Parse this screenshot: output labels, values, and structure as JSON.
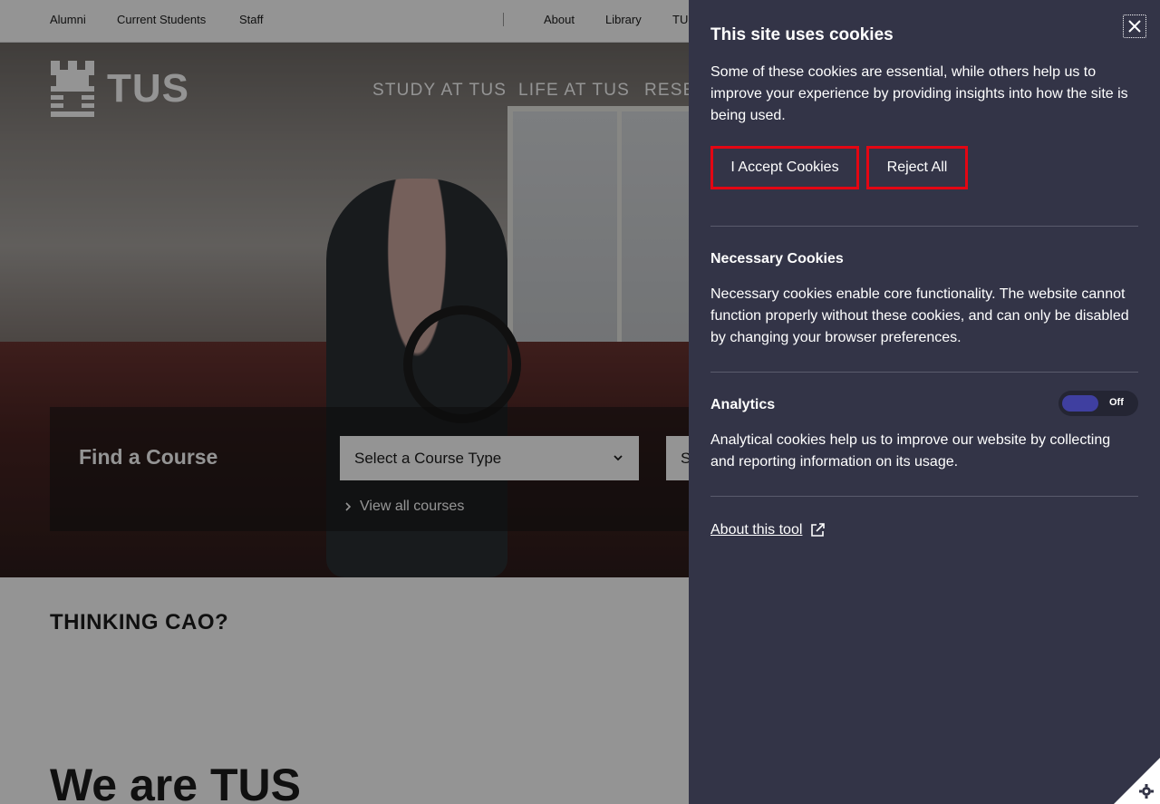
{
  "topbar": {
    "left_links": [
      "Alumni",
      "Current Students",
      "Staff"
    ],
    "right_links": [
      "About",
      "Library",
      "TUS"
    ]
  },
  "logo": {
    "text": "TUS"
  },
  "nav": {
    "items": [
      "STUDY AT TUS",
      "LIFE AT TUS",
      "RESE"
    ]
  },
  "find_course": {
    "title": "Find a Course",
    "course_type_select": "Select a Course Type",
    "second_select": "S",
    "view_all": "View all courses"
  },
  "cao": {
    "title": "THINKING CAO?"
  },
  "intro": {
    "heading": "We are TUS"
  },
  "cookie": {
    "title": "This site uses cookies",
    "intro": "Some of these cookies are essential, while others help us to improve your experience by providing insights into how the site is being used.",
    "accept_label": "I Accept Cookies",
    "reject_label": "Reject All",
    "necessary_title": "Necessary Cookies",
    "necessary_text": "Necessary cookies enable core functionality. The website cannot function properly without these cookies, and can only be disabled by changing your browser preferences.",
    "analytics_title": "Analytics",
    "analytics_toggle": "Off",
    "analytics_text": "Analytical cookies help us to improve our website by collecting and reporting information on its usage.",
    "about_link": "About this tool"
  },
  "colors": {
    "panel_bg": "#333447",
    "button_border": "#e30613",
    "toggle_knob": "#3f3fa0"
  },
  "icons": [
    "close-icon",
    "chevron-down-icon",
    "chevron-right-icon",
    "external-link-icon",
    "gear-icon"
  ]
}
